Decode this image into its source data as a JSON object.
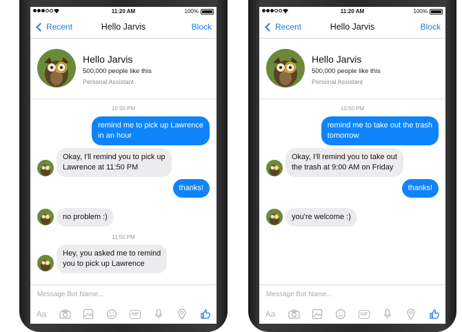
{
  "colors": {
    "accent": "#1b7ce2",
    "outgoing_bubble": "#0f84fa",
    "incoming_bubble": "#ececef"
  },
  "phones": [
    {
      "status": {
        "time": "11:20 AM",
        "battery": "100%"
      },
      "nav": {
        "back_label": "Recent",
        "title": "Hello Jarvis",
        "block_label": "Block"
      },
      "profile": {
        "name": "Hello Jarvis",
        "likes": "500,000 people like this",
        "role": "Personal Assistant"
      },
      "messages": [
        {
          "type": "timestamp",
          "text": "10:50 PM"
        },
        {
          "type": "outgoing",
          "lines": [
            "remind me to pick up Lawrence",
            "in an hour"
          ]
        },
        {
          "type": "incoming",
          "lines": [
            "Okay, I'll remind you to pick up",
            "Lawrence at 11:50 PM"
          ]
        },
        {
          "type": "outgoing",
          "lines": [
            "thanks!"
          ]
        },
        {
          "type": "incoming",
          "lines": [
            "no problem :)"
          ]
        },
        {
          "type": "timestamp",
          "text": "11:50 PM"
        },
        {
          "type": "incoming",
          "lines": [
            "Hey, you asked me to remind",
            "you to pick up Lawrence"
          ]
        }
      ],
      "composer": {
        "placeholder": "Message Bot Name...",
        "aa_label": "Aa",
        "gif_label": "GIF"
      }
    },
    {
      "status": {
        "time": "11:20 AM",
        "battery": "100%"
      },
      "nav": {
        "back_label": "Recent",
        "title": "Hello Jarvis",
        "block_label": "Block"
      },
      "profile": {
        "name": "Hello Jarvis",
        "likes": "500,000 people like this",
        "role": "Personal Assistant"
      },
      "messages": [
        {
          "type": "timestamp",
          "text": "10:50 PM"
        },
        {
          "type": "outgoing",
          "lines": [
            "remind me to take out the trash",
            "tomorrow"
          ]
        },
        {
          "type": "incoming",
          "lines": [
            "Okay, I'll remind you to take out",
            "the trash at 9:00 AM on Friday"
          ]
        },
        {
          "type": "outgoing",
          "lines": [
            "thanks!"
          ]
        },
        {
          "type": "incoming",
          "lines": [
            "you're welcome :)"
          ]
        }
      ],
      "composer": {
        "placeholder": "Message Bot Name...",
        "aa_label": "Aa",
        "gif_label": "GIF"
      }
    }
  ]
}
